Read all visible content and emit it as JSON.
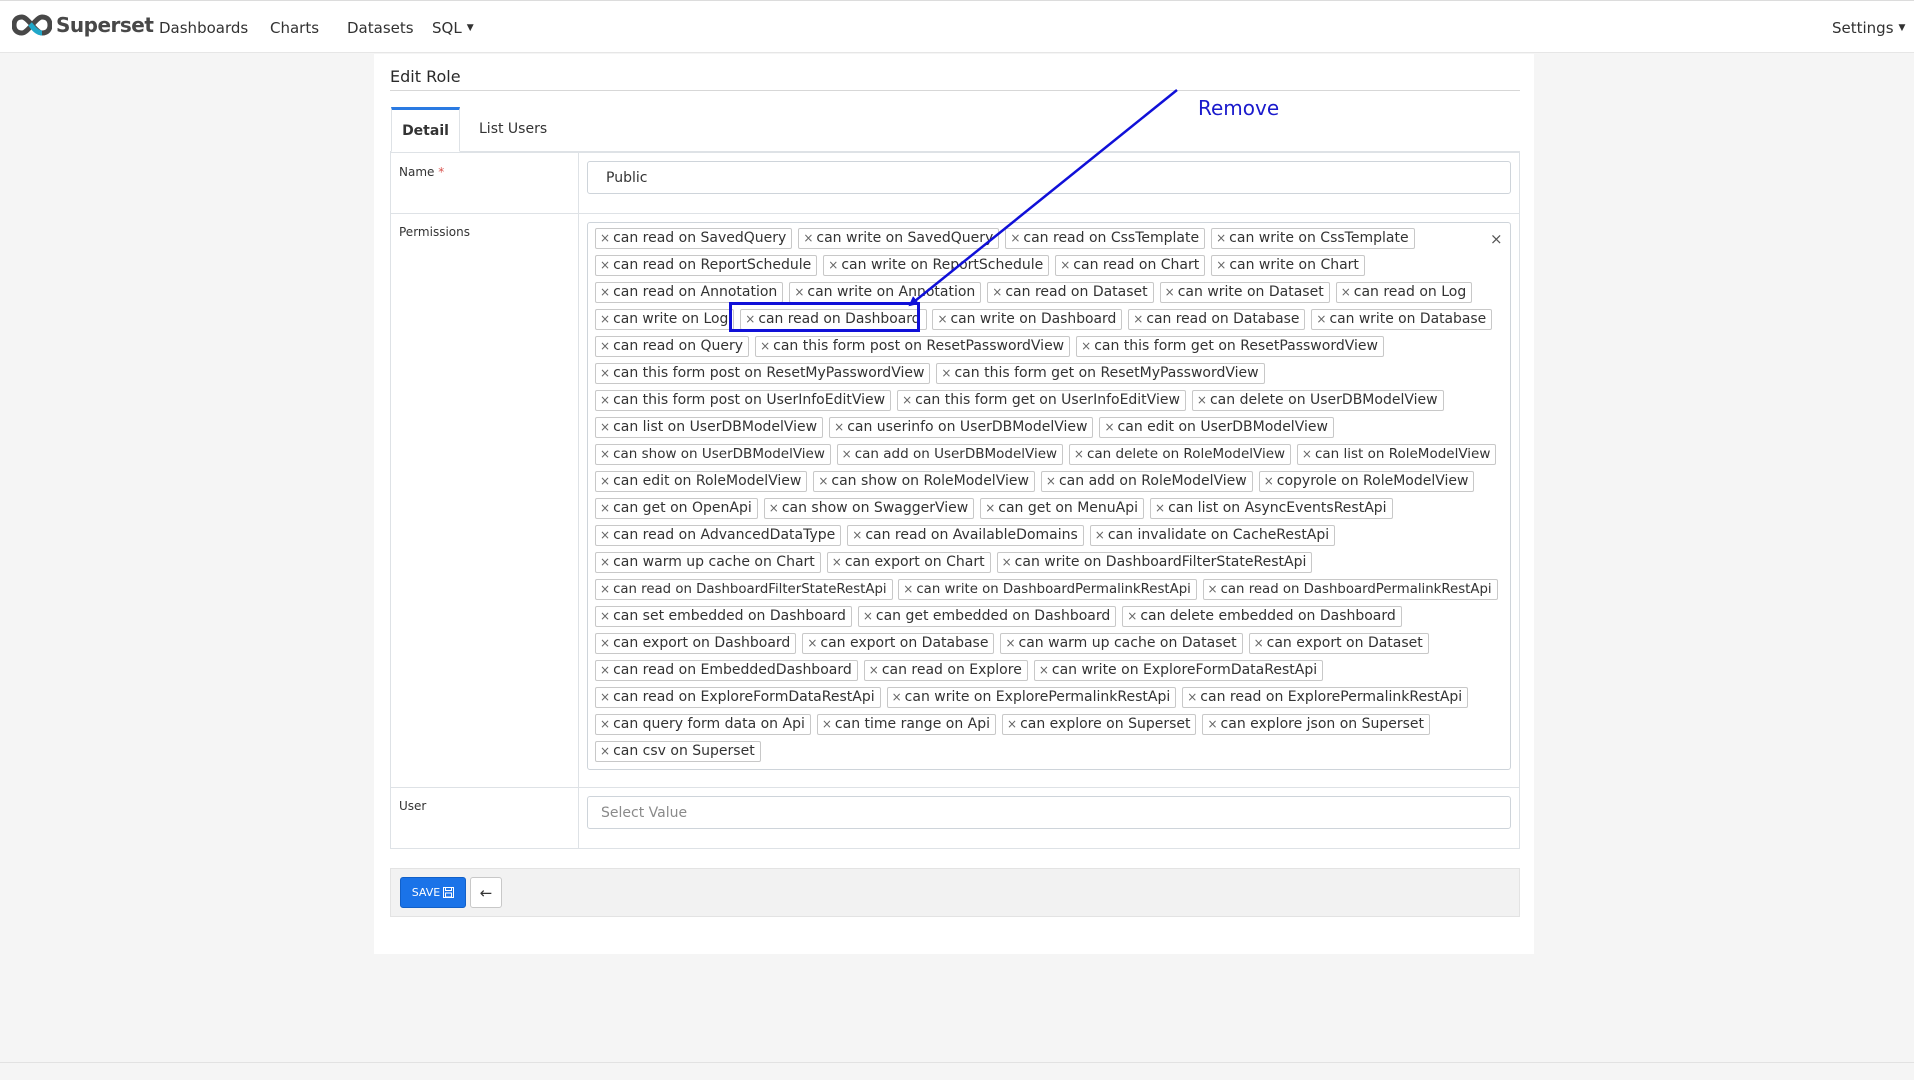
{
  "brand": {
    "name": "Superset"
  },
  "nav": {
    "items": [
      "Dashboards",
      "Charts",
      "Datasets",
      "SQL"
    ],
    "settings": "Settings"
  },
  "page": {
    "title": "Edit Role"
  },
  "tabs": [
    "Detail",
    "List Users"
  ],
  "form": {
    "name_label": "Name",
    "required_mark": "*",
    "name_value": "Public",
    "permissions_label": "Permissions",
    "user_label": "User",
    "user_placeholder": "Select Value"
  },
  "permissions": [
    "can read on SavedQuery",
    "can write on SavedQuery",
    "can read on CssTemplate",
    "can write on CssTemplate",
    "can read on ReportSchedule",
    "can write on ReportSchedule",
    "can read on Chart",
    "can write on Chart",
    "can read on Annotation",
    "can write on Annotation",
    "can read on Dataset",
    "can write on Dataset",
    "can read on Log",
    "can write on Log",
    "can read on Dashboard",
    "can write on Dashboard",
    "can read on Database",
    "can write on Database",
    "can read on Query",
    "can this form post on ResetPasswordView",
    "can this form get on ResetPasswordView",
    "can this form post on ResetMyPasswordView",
    "can this form get on ResetMyPasswordView",
    "can this form post on UserInfoEditView",
    "can this form get on UserInfoEditView",
    "can delete on UserDBModelView",
    "can list on UserDBModelView",
    "can userinfo on UserDBModelView",
    "can edit on UserDBModelView",
    "can show on UserDBModelView",
    "can add on UserDBModelView",
    "can delete on RoleModelView",
    "can list on RoleModelView",
    "can edit on RoleModelView",
    "can show on RoleModelView",
    "can add on RoleModelView",
    "copyrole on RoleModelView",
    "can get on OpenApi",
    "can show on SwaggerView",
    "can get on MenuApi",
    "can list on AsyncEventsRestApi",
    "can read on AdvancedDataType",
    "can read on AvailableDomains",
    "can invalidate on CacheRestApi",
    "can warm up cache on Chart",
    "can export on Chart",
    "can write on DashboardFilterStateRestApi",
    "can read on DashboardFilterStateRestApi",
    "can write on DashboardPermalinkRestApi",
    "can read on DashboardPermalinkRestApi",
    "can set embedded on Dashboard",
    "can get embedded on Dashboard",
    "can delete embedded on Dashboard",
    "can export on Dashboard",
    "can export on Database",
    "can warm up cache on Dataset",
    "can export on Dataset",
    "can read on EmbeddedDashboard",
    "can read on Explore",
    "can write on ExploreFormDataRestApi",
    "can read on ExploreFormDataRestApi",
    "can write on ExplorePermalinkRestApi",
    "can read on ExplorePermalinkRestApi",
    "can query form data on Api",
    "can time range on Api",
    "can explore on Superset",
    "can explore json on Superset",
    "can csv on Superset"
  ],
  "chip_remove_glyph": "×",
  "clear_all_glyph": "×",
  "annotation": {
    "text": "Remove",
    "target": "can read on Dashboard",
    "color": "#1010d8"
  },
  "actions": {
    "save_label": "SAVE",
    "back_icon": "arrow-left-icon"
  },
  "colors": {
    "primary": "#1a73e8",
    "tab_active": "#2a7ae2",
    "annotation": "#1010d8"
  }
}
